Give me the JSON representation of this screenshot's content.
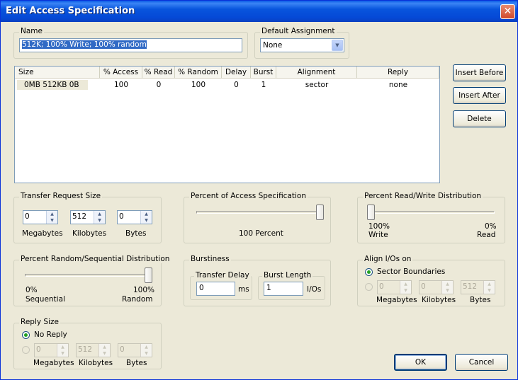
{
  "window": {
    "title": "Edit Access Specification",
    "close_icon": "close-icon"
  },
  "name_group": {
    "legend": "Name",
    "value": "512K; 100% Write; 100% random"
  },
  "default_assignment": {
    "legend": "Default Assignment",
    "selected": "None"
  },
  "list": {
    "columns": [
      "Size",
      "% Access",
      "% Read",
      "% Random",
      "Delay",
      "Burst",
      "Alignment",
      "Reply"
    ],
    "rows": [
      {
        "size": "0MB  512KB   0B",
        "access": "100",
        "read": "0",
        "random": "100",
        "delay": "0",
        "burst": "1",
        "alignment": "sector",
        "reply": "none"
      }
    ]
  },
  "side_buttons": {
    "insert_before": "Insert Before",
    "insert_after": "Insert After",
    "delete": "Delete"
  },
  "transfer_request_size": {
    "legend": "Transfer Request Size",
    "megabytes": "0",
    "kilobytes": "512",
    "bytes": "0",
    "megabytes_label": "Megabytes",
    "kilobytes_label": "Kilobytes",
    "bytes_label": "Bytes"
  },
  "percent_access": {
    "legend": "Percent of Access Specification",
    "value_label": "100 Percent",
    "level": 100
  },
  "percent_rw": {
    "legend": "Percent Read/Write Distribution",
    "left_pct": "100%",
    "left_label": "Write",
    "right_pct": "0%",
    "right_label": "Read",
    "read_level": 0
  },
  "percent_random": {
    "legend": "Percent Random/Sequential Distribution",
    "left_pct": "0%",
    "left_label": "Sequential",
    "right_pct": "100%",
    "right_label": "Random",
    "random_level": 100
  },
  "burstiness": {
    "legend": "Burstiness",
    "transfer_delay_legend": "Transfer Delay",
    "transfer_delay": "0",
    "transfer_delay_unit": "ms",
    "burst_length_legend": "Burst Length",
    "burst_length": "1",
    "burst_length_unit": "I/Os"
  },
  "align_ios": {
    "legend": "Align I/Os on",
    "sector_label": "Sector Boundaries",
    "megabytes": "0",
    "kilobytes": "0",
    "bytes": "512",
    "megabytes_label": "Megabytes",
    "kilobytes_label": "Kilobytes",
    "bytes_label": "Bytes"
  },
  "reply_size": {
    "legend": "Reply Size",
    "no_reply_label": "No Reply",
    "megabytes": "0",
    "kilobytes": "512",
    "bytes": "0",
    "megabytes_label": "Megabytes",
    "kilobytes_label": "Kilobytes",
    "bytes_label": "Bytes"
  },
  "footer": {
    "ok": "OK",
    "cancel": "Cancel"
  }
}
